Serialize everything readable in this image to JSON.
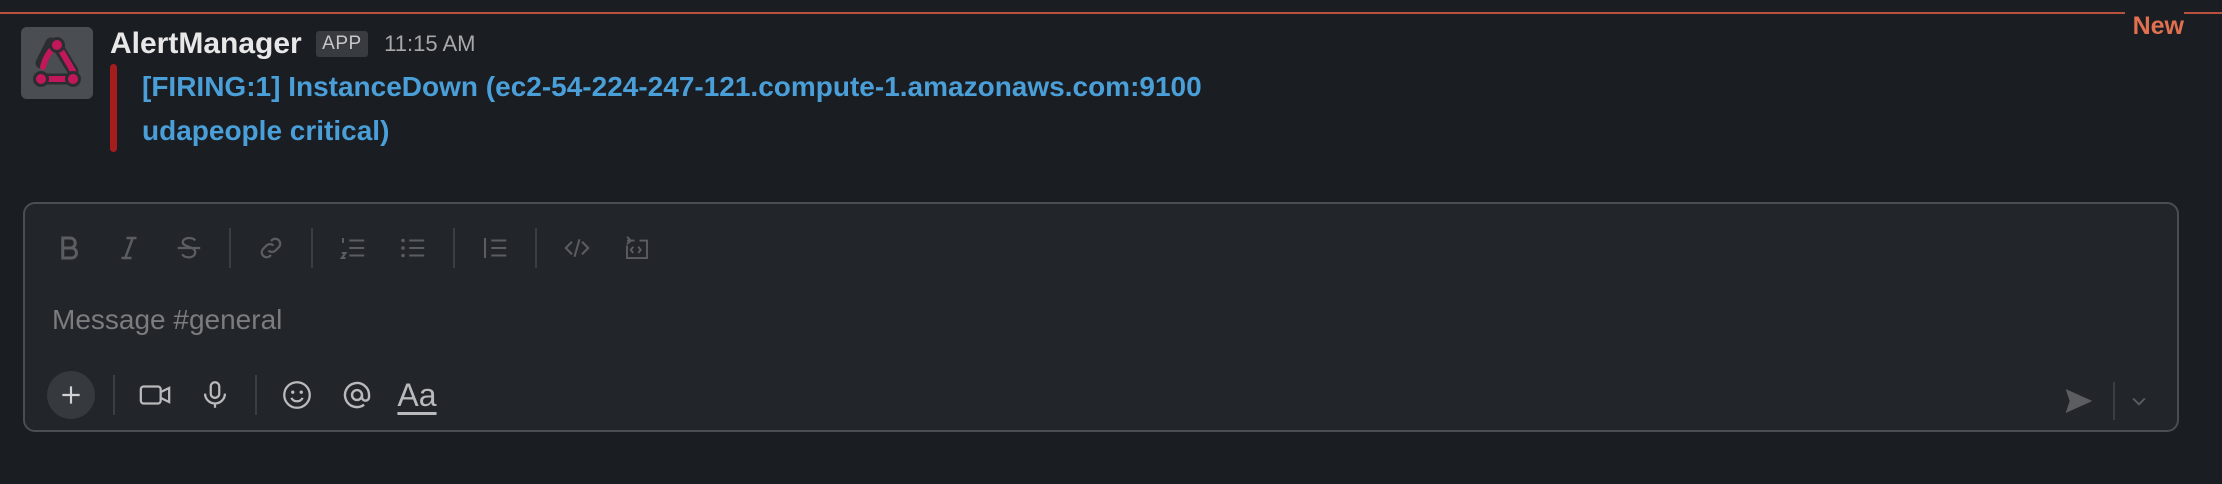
{
  "divider": {
    "label": "New"
  },
  "message": {
    "sender": "AlertManager",
    "badge": "APP",
    "time": "11:15 AM",
    "alert_line1": "[FIRING:1] InstanceDown (ec2-54-224-247-121.compute-1.amazonaws.com:9100",
    "alert_line2": "udapeople critical)",
    "accent_color": "#a51d1d",
    "link_color": "#4a9fd8"
  },
  "composer": {
    "placeholder": "Message #general",
    "text_format_label": "Aa",
    "format_tools": [
      "bold-icon",
      "italic-icon",
      "strikethrough-icon",
      "link-icon",
      "ordered-list-icon",
      "bulleted-list-icon",
      "blockquote-icon",
      "code-icon",
      "code-block-icon"
    ],
    "bottom_tools": [
      "plus-icon",
      "video-icon",
      "microphone-icon",
      "emoji-icon",
      "mention-icon",
      "text-format-icon"
    ],
    "send_icons": [
      "send-icon",
      "chevron-down-icon"
    ]
  }
}
